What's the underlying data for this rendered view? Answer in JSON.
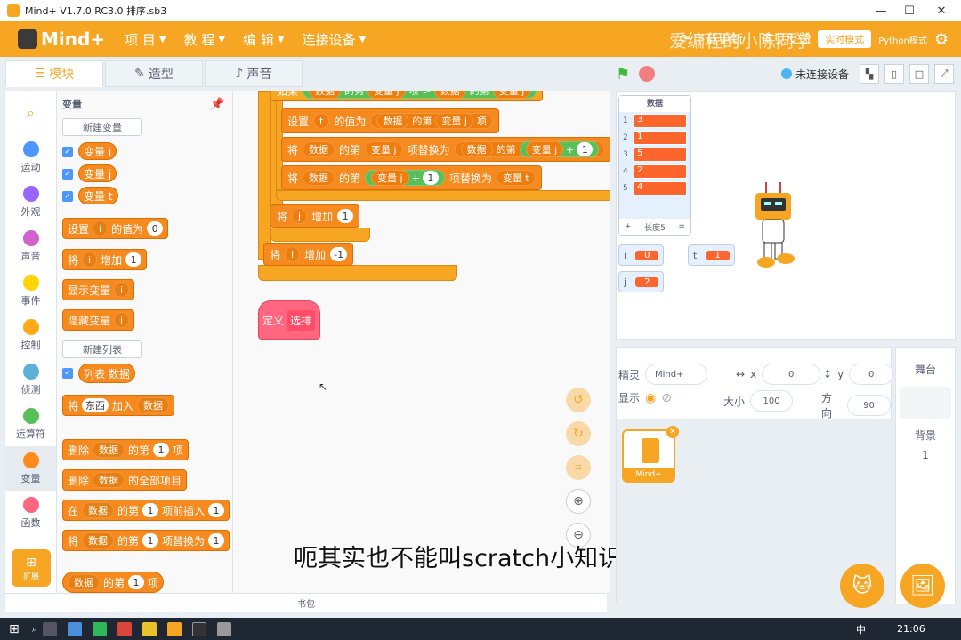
{
  "window": {
    "title": "Mind+ V1.7.0 RC3.0   排序.sb3",
    "min": "—",
    "max": "☐",
    "close": "✕"
  },
  "menu": {
    "logo": "Mind+",
    "items": [
      {
        "label": "项 目"
      },
      {
        "label": "教 程"
      },
      {
        "label": "编 辑"
      },
      {
        "label": "连接设备"
      }
    ],
    "download": "下载更新",
    "feedback": "意见反馈",
    "mode_button": "实时模式",
    "python_label": "Python模式"
  },
  "watermark": "爱编程的小陈同学",
  "tabs": [
    {
      "label": "模块"
    },
    {
      "label": "造型"
    },
    {
      "label": "声音"
    }
  ],
  "connection": "未连接设备",
  "categories": [
    {
      "label": "运动",
      "color": "#4c97ff"
    },
    {
      "label": "外观",
      "color": "#9966ff"
    },
    {
      "label": "声音",
      "color": "#cf63cf"
    },
    {
      "label": "事件",
      "color": "#ffd500"
    },
    {
      "label": "控制",
      "color": "#ffab19"
    },
    {
      "label": "侦测",
      "color": "#5cb1d6"
    },
    {
      "label": "运算符",
      "color": "#59c059"
    },
    {
      "label": "变量",
      "color": "#ff8c1a"
    },
    {
      "label": "函数",
      "color": "#ff6680"
    }
  ],
  "extension": "扩展",
  "palette": {
    "title": "变量",
    "new_var": "新建变量",
    "vars": [
      "变量 i",
      "变量 j",
      "变量 t"
    ],
    "set_label": "设置",
    "set_var": "i",
    "set_to": "的值为",
    "set_val": "0",
    "change_label": "将",
    "change_var": "i",
    "change_by": "增加",
    "change_val": "1",
    "show_var": "显示变量",
    "show_var_name": "i",
    "hide_var": "隐藏变量",
    "hide_var_name": "i",
    "new_list": "新建列表",
    "list_reporter": "列表 数据",
    "add_label": "将",
    "add_item": "东西",
    "add_to": "加入",
    "add_list": "数据",
    "del_label": "删除",
    "del_list": "数据",
    "del_of": "的第",
    "del_idx": "1",
    "del_item": "项",
    "delall_label": "删除",
    "delall_list": "数据",
    "delall_suffix": "的全部项目",
    "ins_label": "在",
    "ins_list": "数据",
    "ins_of": "的第",
    "ins_idx": "1",
    "ins_mid": "项前插入",
    "ins_val": "1",
    "rep_label": "将",
    "rep_list": "数据",
    "rep_of": "的第",
    "rep_idx": "1",
    "rep_mid": "项替换为",
    "rep_val": "1",
    "item_list": "数据",
    "item_of": "的第",
    "item_idx": "1",
    "item_suffix": "项"
  },
  "script": {
    "top_if": "如果",
    "top_a": "数据",
    "top_b": "的第",
    "top_c": "变量 j",
    "top_d": "项",
    "top_e": ">",
    "top_f": "数据",
    "top_g": "的第",
    "top_h": "变量 j",
    "set_label": "设置",
    "set_var": "t",
    "set_to": "的值为",
    "set_list": "数据",
    "set_of": "的第",
    "set_idx": "变量 j",
    "set_item": "项",
    "rep1_label": "将",
    "rep1_list": "数据",
    "rep1_of": "的第",
    "rep1_idx": "变量 j",
    "rep1_mid": "项替换为",
    "rep1_list2": "数据",
    "rep1_of2": "的第",
    "rep1_idx2": "变量 j",
    "rep1_plus": "+",
    "rep1_num": "1",
    "rep2_label": "将",
    "rep2_list": "数据",
    "rep2_of": "的第",
    "rep2_idx": "变量 j",
    "rep2_plus": "+",
    "rep2_num": "1",
    "rep2_mid": "项替换为",
    "rep2_val": "变量 t",
    "chj_label": "将",
    "chj_var": "j",
    "chj_by": "增加",
    "chj_val": "1",
    "chi_label": "将",
    "chi_var": "i",
    "chi_by": "增加",
    "chi_val": "-1",
    "define_label": "定义",
    "define_name": "选排"
  },
  "subtitle": "呃其实也不能叫scratch小知识",
  "backpack": "书包",
  "stage": {
    "list_title": "数据",
    "list_items": [
      {
        "idx": "1",
        "val": "3"
      },
      {
        "idx": "2",
        "val": "1"
      },
      {
        "idx": "3",
        "val": "5"
      },
      {
        "idx": "4",
        "val": "2"
      },
      {
        "idx": "5",
        "val": "4"
      }
    ],
    "list_add": "+",
    "list_length": "长度5",
    "list_eq": "=",
    "vars": [
      {
        "name": "i",
        "value": "0"
      },
      {
        "name": "t",
        "value": "1"
      },
      {
        "name": "j",
        "value": "2"
      }
    ]
  },
  "sprite_info": {
    "sprite_label": "精灵",
    "sprite_name": "Mind+",
    "x_label": "x",
    "x_val": "0",
    "y_label": "y",
    "y_val": "0",
    "show_label": "显示",
    "size_label": "大小",
    "size_val": "100",
    "dir_label": "方向",
    "dir_val": "90",
    "thumb_name": "Mind+"
  },
  "stage_panel": {
    "title": "舞台",
    "bg_label": "背景",
    "bg_count": "1"
  },
  "taskbar": {
    "lang": "中",
    "time": "21:06"
  }
}
